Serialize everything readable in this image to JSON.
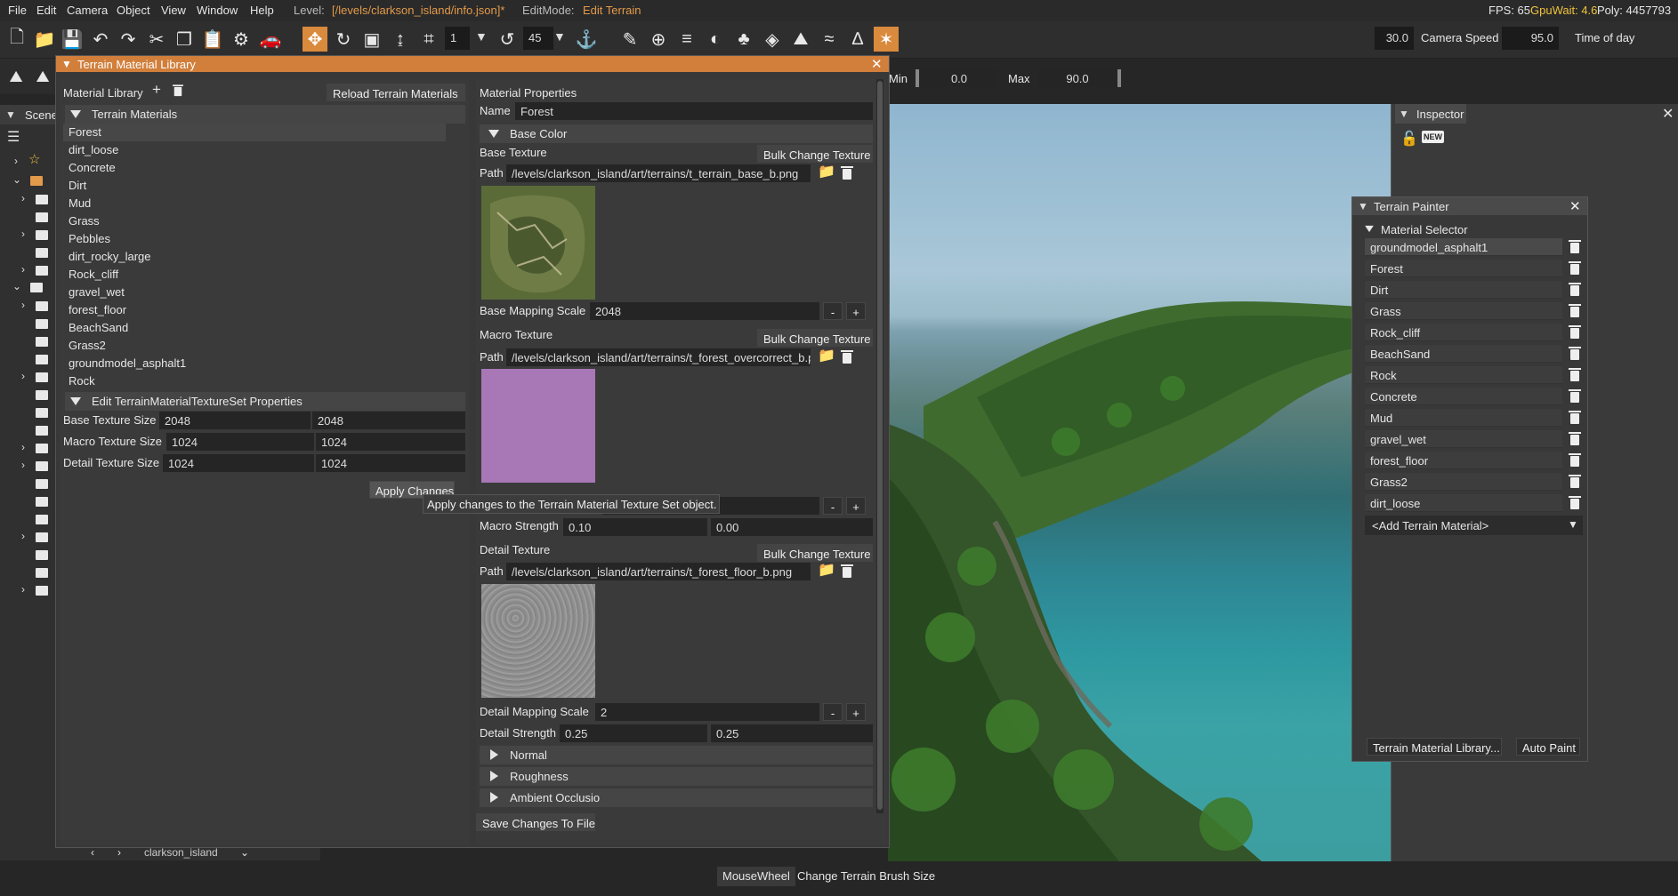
{
  "menu": {
    "items": [
      "File",
      "Edit",
      "Camera",
      "Object",
      "View",
      "Window",
      "Help"
    ],
    "level_label": "Level:",
    "level_value": "[/levels/clarkson_island/info.json]*",
    "editmode_label": "EditMode:",
    "editmode_value": "Edit Terrain",
    "fps_label": "FPS: 65",
    "gpuwait_label": "GpuWait: 4.6",
    "poly_label": "Poly: 4457793"
  },
  "toolbar": {
    "snap_value": "1",
    "angle_value": "45",
    "fov_value": "30.0",
    "camera_speed_label": "Camera Speed",
    "camera_speed_value": "95.0",
    "time_of_day_label": "Time of day"
  },
  "range": {
    "min_label": "Min",
    "min_value": "0.0",
    "max_label": "Max",
    "max_value": "90.0"
  },
  "scene_tab_label": "Scene",
  "bottom_bar": {
    "nav_text": "clarkson_island",
    "hint_key": "MouseWheel",
    "hint_text": "Change Terrain Brush Size"
  },
  "material_library": {
    "title": "Terrain Material Library",
    "library_label": "Material Library",
    "add_symbol": "+",
    "reload_button": "Reload Terrain Materials",
    "materials_header": "Terrain Materials",
    "materials": [
      "Forest",
      "dirt_loose",
      "Concrete",
      "Dirt",
      "Mud",
      "Grass",
      "Pebbles",
      "dirt_rocky_large",
      "Rock_cliff",
      "gravel_wet",
      "forest_floor",
      "BeachSand",
      "Grass2",
      "groundmodel_asphalt1",
      "Rock"
    ],
    "textureset_header": "Edit TerrainMaterialTextureSet Properties",
    "base_texture_size_label": "Base Texture Size",
    "base_texture_size": [
      "2048",
      "2048"
    ],
    "macro_texture_size_label": "Macro Texture Size",
    "macro_texture_size": [
      "1024",
      "1024"
    ],
    "detail_texture_size_label": "Detail Texture Size",
    "detail_texture_size": [
      "1024",
      "1024"
    ],
    "apply_button": "Apply Changes",
    "apply_tooltip": "Apply changes to the Terrain Material Texture Set object."
  },
  "properties": {
    "title": "Material Properties",
    "name_label": "Name",
    "name_value": "Forest",
    "base_color_header": "Base Color",
    "base_texture_label": "Base Texture",
    "bulk_change_label": "Bulk Change Texture",
    "path_label": "Path",
    "base_path": "/levels/clarkson_island/art/terrains/t_terrain_base_b.png",
    "base_mapping_label": "Base Mapping Scale",
    "base_mapping_value": "2048",
    "minus": "-",
    "plus": "+",
    "macro_texture_label": "Macro Texture",
    "macro_path": "/levels/clarkson_island/art/terrains/t_forest_overcorrect_b.png",
    "macro_strength_label": "Macro Strength",
    "macro_strength": [
      "0.10",
      "0.00"
    ],
    "detail_texture_label": "Detail Texture",
    "detail_path": "/levels/clarkson_island/art/terrains/t_forest_floor_b.png",
    "detail_mapping_label": "Detail Mapping Scale",
    "detail_mapping_value": "2",
    "detail_strength_label": "Detail Strength",
    "detail_strength": [
      "0.25",
      "0.25"
    ],
    "normal_header": "Normal",
    "roughness_header": "Roughness",
    "ambient_header": "Ambient Occlusio",
    "save_button": "Save Changes To File"
  },
  "inspector": {
    "title": "Inspector",
    "new_label": "NEW"
  },
  "painter": {
    "title": "Terrain Painter",
    "selector_header": "Material Selector",
    "materials": [
      "groundmodel_asphalt1",
      "Forest",
      "Dirt",
      "Grass",
      "Rock_cliff",
      "BeachSand",
      "Rock",
      "Concrete",
      "Mud",
      "gravel_wet",
      "forest_floor",
      "Grass2",
      "dirt_loose"
    ],
    "add_material": "<Add Terrain Material>",
    "library_button": "Terrain Material Library...",
    "auto_paint_button": "Auto Paint"
  },
  "colors": {
    "accent": "#d17f3b",
    "level_text": "#e39a4a",
    "gpuwait_text": "#f0c43a",
    "macro_swatch": "#a877b5"
  }
}
